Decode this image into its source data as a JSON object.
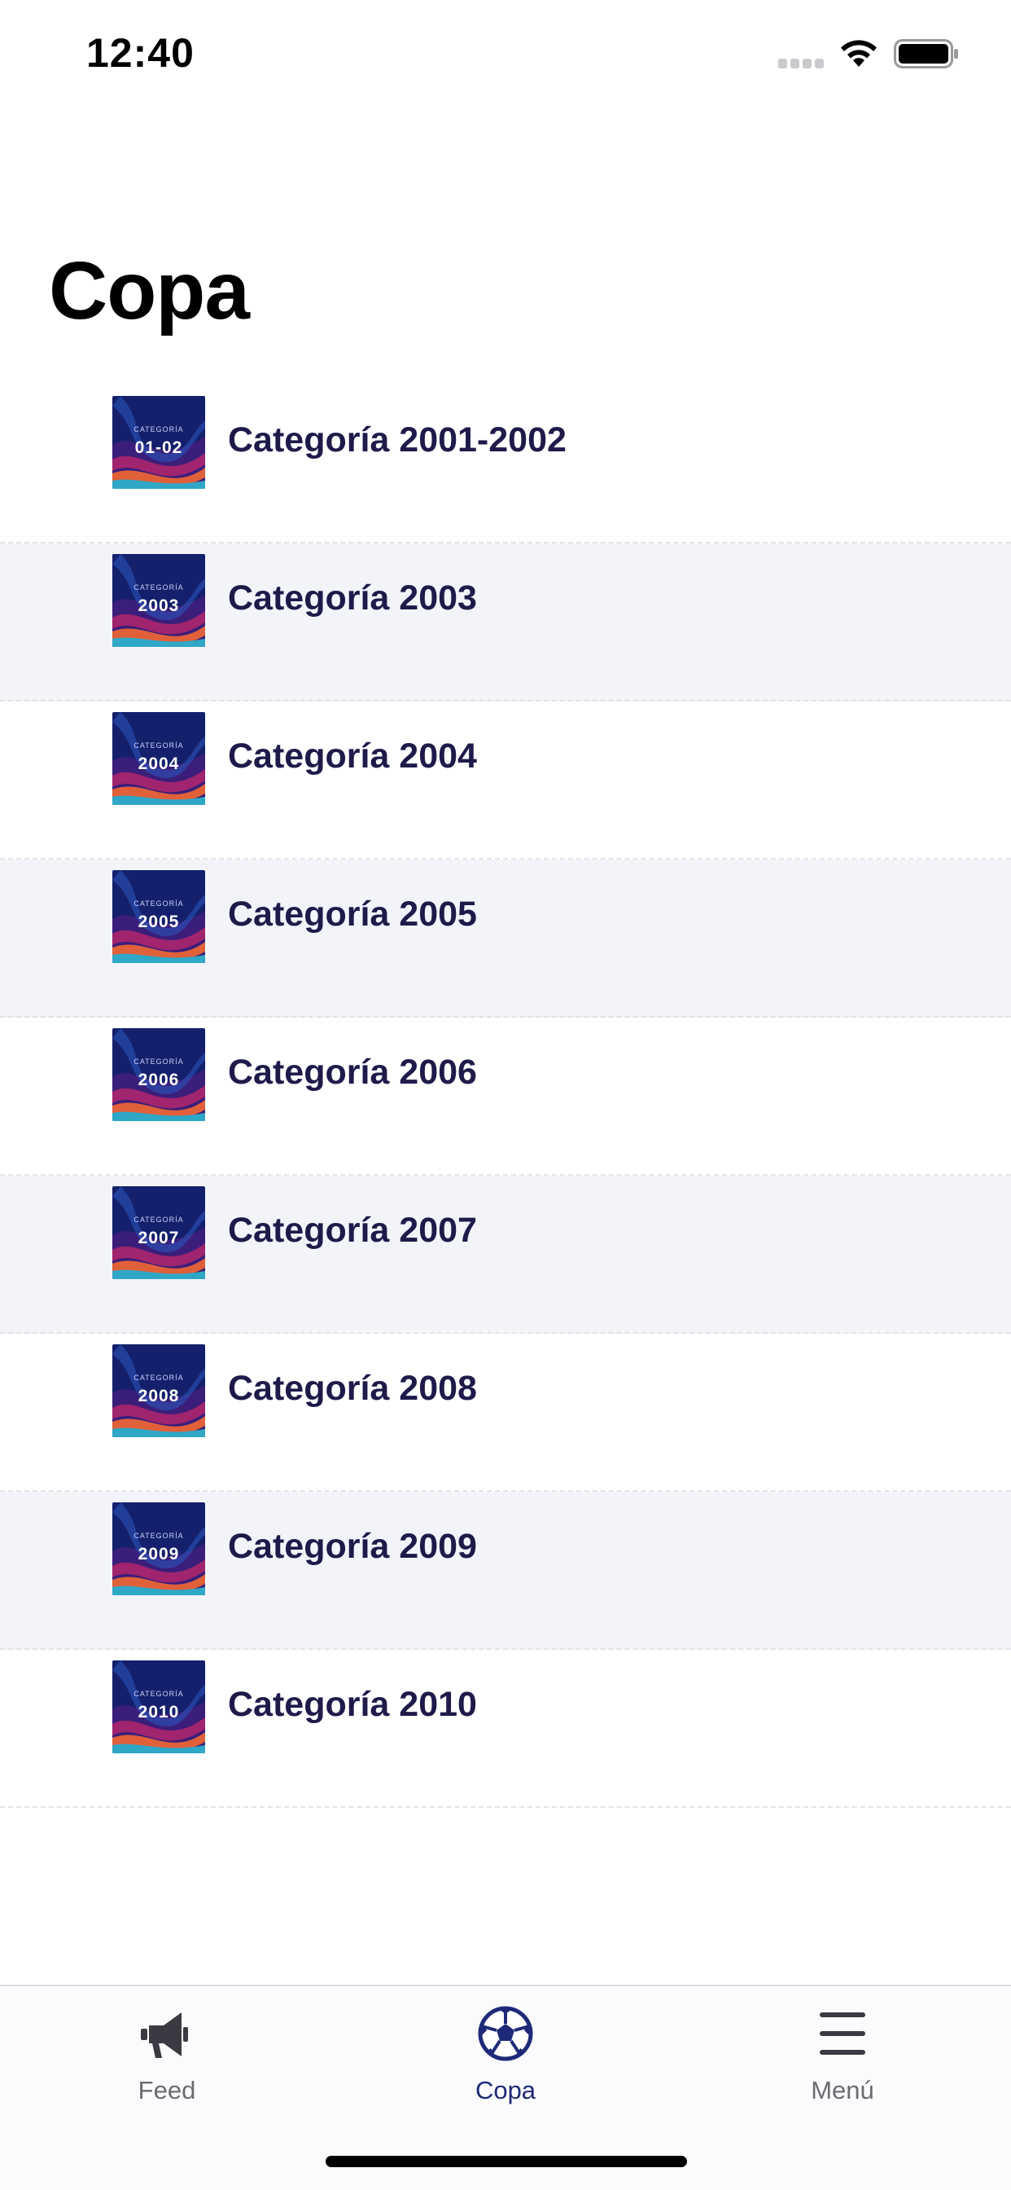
{
  "status_bar": {
    "time": "12:40"
  },
  "page": {
    "title": "Copa"
  },
  "categories": [
    {
      "thumb_small": "CATEGORÍA",
      "thumb_code": "01-02",
      "label": "Categoría 2001-2002"
    },
    {
      "thumb_small": "CATEGORÍA",
      "thumb_code": "2003",
      "label": "Categoría 2003"
    },
    {
      "thumb_small": "CATEGORÍA",
      "thumb_code": "2004",
      "label": "Categoría 2004"
    },
    {
      "thumb_small": "CATEGORÍA",
      "thumb_code": "2005",
      "label": "Categoría 2005"
    },
    {
      "thumb_small": "CATEGORÍA",
      "thumb_code": "2006",
      "label": "Categoría 2006"
    },
    {
      "thumb_small": "CATEGORÍA",
      "thumb_code": "2007",
      "label": "Categoría 2007"
    },
    {
      "thumb_small": "CATEGORÍA",
      "thumb_code": "2008",
      "label": "Categoría 2008"
    },
    {
      "thumb_small": "CATEGORÍA",
      "thumb_code": "2009",
      "label": "Categoría 2009"
    },
    {
      "thumb_small": "CATEGORÍA",
      "thumb_code": "2010",
      "label": "Categoría 2010"
    }
  ],
  "tab_bar": {
    "tabs": [
      {
        "label": "Feed",
        "icon": "megaphone-icon",
        "active": false
      },
      {
        "label": "Copa",
        "icon": "soccer-ball-icon",
        "active": true
      },
      {
        "label": "Menú",
        "icon": "hamburger-menu-icon",
        "active": false
      }
    ]
  },
  "colors": {
    "accent": "#1e2a78",
    "label_text": "#1e1b4b",
    "row_alt_bg": "#f3f4fa",
    "inactive_tab": "#6b6b73"
  }
}
